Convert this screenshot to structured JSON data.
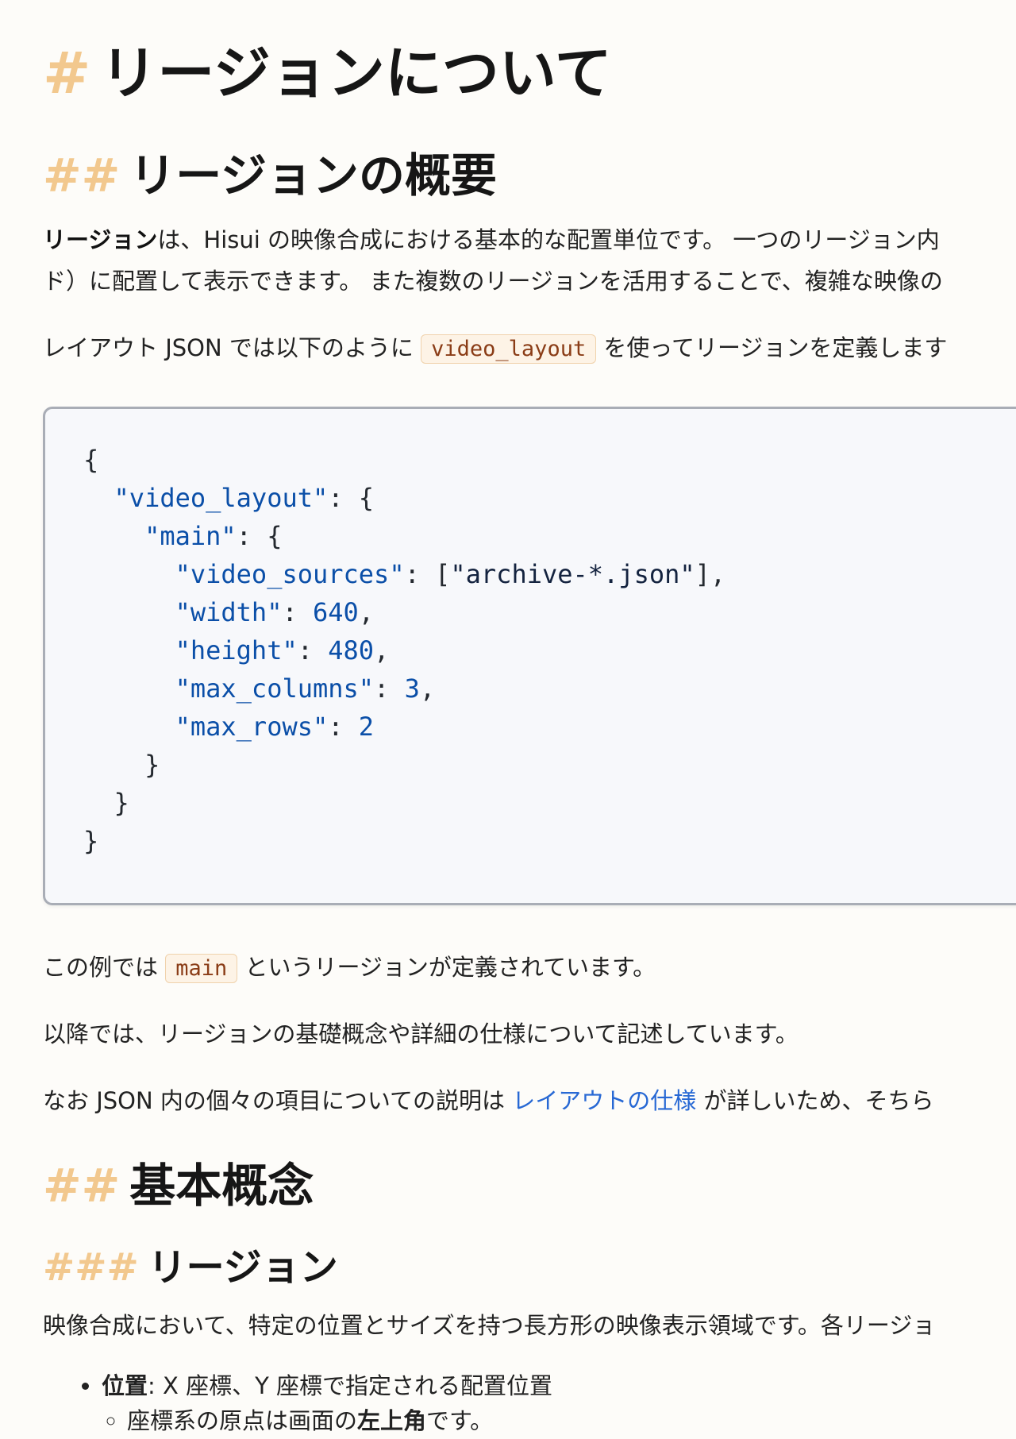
{
  "page": {
    "title": "リージョンについて",
    "title_mark": "#"
  },
  "section_overview": {
    "mark": "##",
    "heading": "リージョンの概要",
    "p1_bold": "リージョン",
    "p1_line1_rest": "は、Hisui の映像合成における基本的な配置単位です。 一つのリージョン内",
    "p1_line2": "ド）に配置して表示できます。 また複数のリージョンを活用することで、複雑な映像の",
    "p2_before": "レイアウト JSON では以下のように ",
    "p2_code": "video_layout",
    "p2_after": " を使ってリージョンを定義します",
    "code_lines": {
      "l1": "{",
      "l2_key": "\"video_layout\"",
      "l2_rest": ": {",
      "l3_key": "\"main\"",
      "l3_rest": ": {",
      "l4_key": "\"video_sources\"",
      "l4_mid": ": [",
      "l4_val": "\"archive-*.json\"",
      "l4_rest": "],",
      "l5_key": "\"width\"",
      "l5_val": "640",
      "l6_key": "\"height\"",
      "l6_val": "480",
      "l7_key": "\"max_columns\"",
      "l7_val": "3",
      "l8_key": "\"max_rows\"",
      "l8_val": "2",
      "l9": "}",
      "l10": "}",
      "l11": "}"
    },
    "p3_before": "この例では ",
    "p3_code": "main",
    "p3_after": " というリージョンが定義されています。",
    "p4": "以降では、リージョンの基礎概念や詳細の仕様について記述しています。",
    "p5_before": "なお JSON 内の個々の項目についての説明は ",
    "p5_link": "レイアウトの仕様",
    "p5_after": " が詳しいため、そちら"
  },
  "section_basics": {
    "mark": "##",
    "heading": "基本概念",
    "sub_mark": "###",
    "sub_heading": "リージョン",
    "p1": "映像合成において、特定の位置とサイズを持つ長方形の映像表示領域です。各リージョ",
    "bullet1_bold": "位置",
    "bullet1_rest": ": X 座標、Y 座標で指定される配置位置",
    "sub_bullet_before": "座標系の原点は画面の",
    "sub_bullet_bold": "左上角",
    "sub_bullet_after": "です。"
  },
  "colors": {
    "background": "#fdfcf9",
    "heading_mark": "#f2c88e",
    "link": "#2768d4",
    "code_key": "#0b4fa8"
  }
}
